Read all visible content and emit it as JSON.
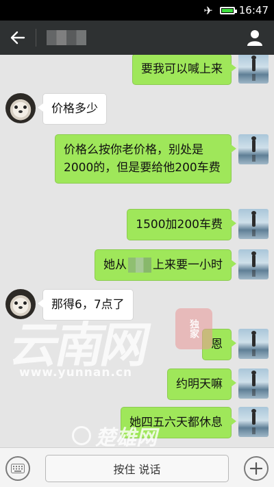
{
  "status_bar": {
    "time": "16:47",
    "airplane_icon": "airplane-icon",
    "battery_icon": "battery-icon"
  },
  "header": {
    "title": "",
    "back_icon": "arrow-left-icon",
    "profile_icon": "person-icon"
  },
  "messages": [
    {
      "side": "self",
      "text": "要我可以喊上来"
    },
    {
      "side": "other",
      "text": "价格多少"
    },
    {
      "side": "self",
      "text": "价格么按你老价格，别处是2000的，但是要给他200车费"
    },
    {
      "side": "self",
      "text": "1500加200车费"
    },
    {
      "side": "self",
      "text_before": "她从",
      "text_after": "上来要一小时"
    },
    {
      "side": "other",
      "text": "那得6，7点了"
    },
    {
      "side": "self",
      "text": "恩"
    },
    {
      "side": "self",
      "text": "约明天嘛"
    },
    {
      "side": "self",
      "text": "她四五六天都休息"
    }
  ],
  "watermark": {
    "main": "云南网",
    "seal": "独家",
    "url": "www.yunnan.cn",
    "bottom": "楚雄网"
  },
  "input_bar": {
    "keyboard_icon": "keyboard-icon",
    "talk_label": "按住 说话",
    "plus_icon": "plus-icon"
  }
}
